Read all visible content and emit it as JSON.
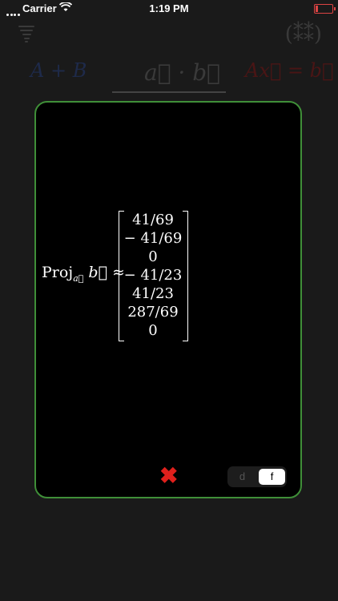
{
  "status_bar": {
    "carrier": "Carrier",
    "time": "1:19 PM"
  },
  "tabs": {
    "add": "A + B",
    "dot": "a⃗ · b⃗",
    "solve": "Ax⃗ = b⃗"
  },
  "result": {
    "label": "Proj",
    "label_sub": "a⃗",
    "label_vec": "b⃗",
    "relation": "≈",
    "vector": [
      "41/69",
      "− 41/69",
      "0",
      "− 41/23",
      "41/23",
      "287/69",
      "0"
    ]
  },
  "controls": {
    "close_glyph": "✖",
    "segment_options": [
      "d",
      "f"
    ],
    "segment_selected": "f"
  },
  "colors": {
    "modal_border": "#3f8f38",
    "close": "#e0201c",
    "background": "#1a1a1a"
  }
}
